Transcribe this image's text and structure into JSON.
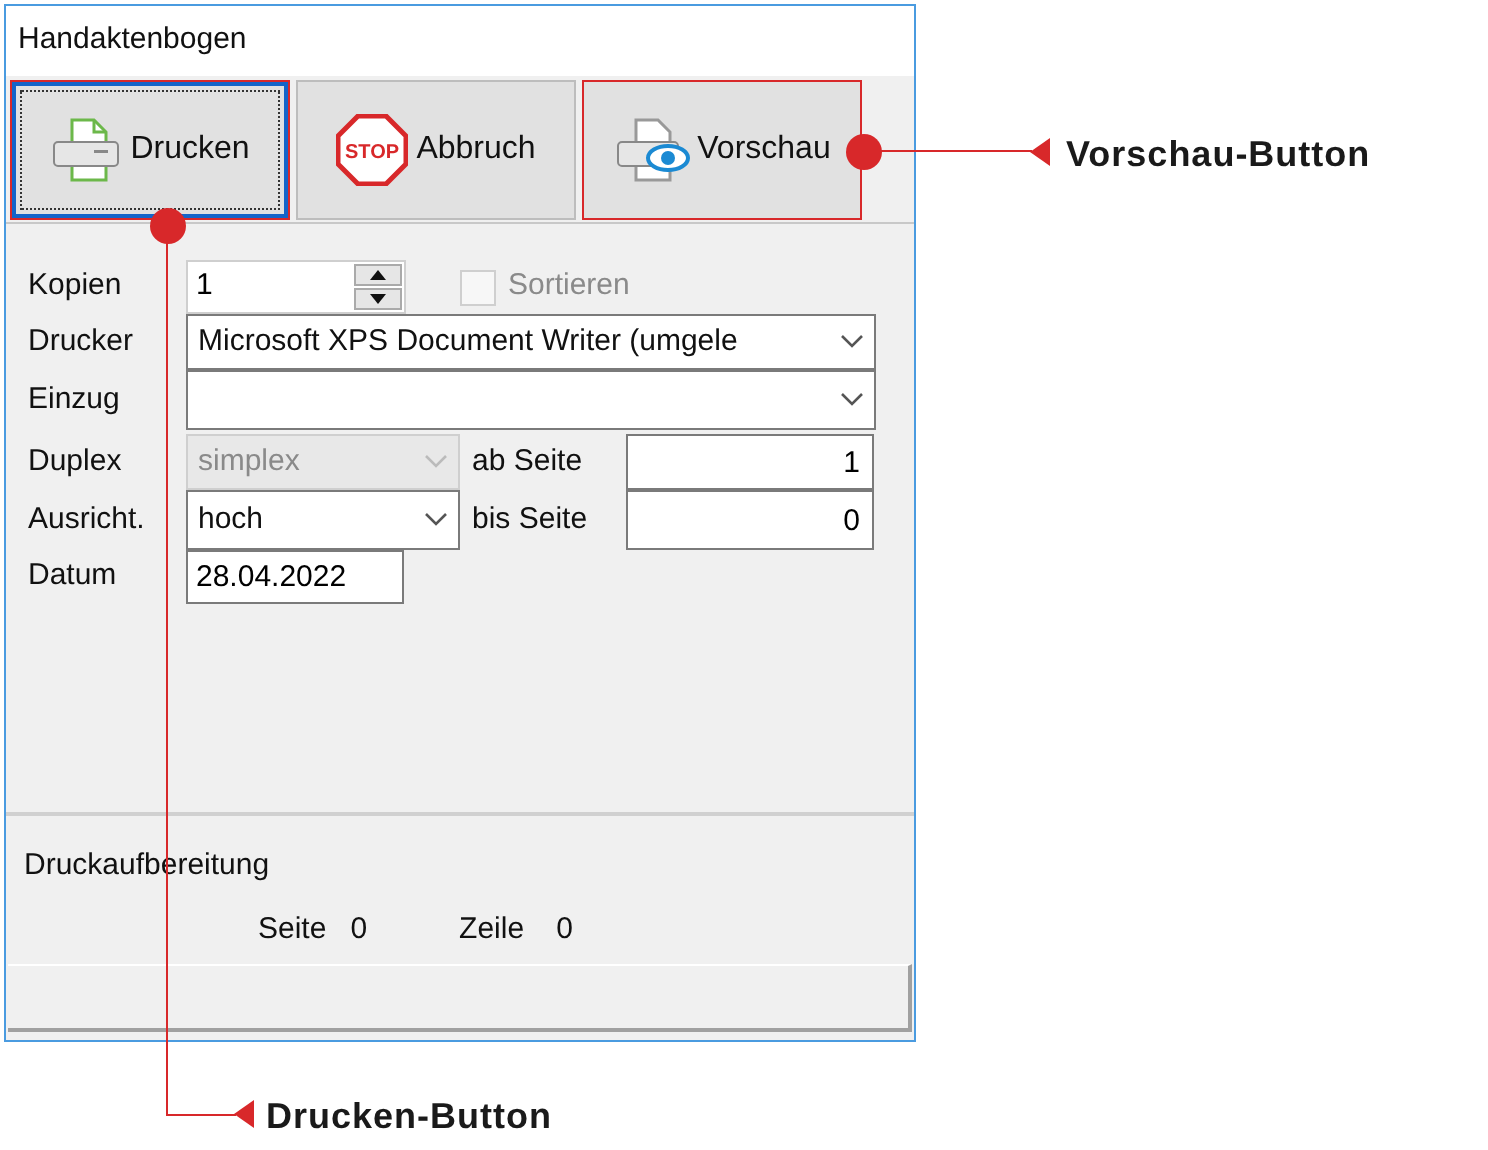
{
  "window": {
    "title": "Handaktenbogen"
  },
  "toolbar": [
    {
      "kind": "print",
      "label": "Drucken",
      "focused": true,
      "highlighted": true
    },
    {
      "kind": "stop",
      "label": "Abbruch",
      "icon_text": "STOP",
      "focused": false,
      "highlighted": false
    },
    {
      "kind": "preview",
      "label": "Vorschau",
      "focused": false,
      "highlighted": true
    }
  ],
  "form": {
    "copies": {
      "label": "Kopien",
      "value": "1"
    },
    "collate": {
      "label": "Sortieren",
      "checked": false,
      "disabled": true
    },
    "printer": {
      "label": "Drucker",
      "value": "Microsoft XPS Document Writer (umgele"
    },
    "tray": {
      "label": "Einzug"
    },
    "duplex": {
      "label": "Duplex",
      "value": "simplex",
      "disabled": true
    },
    "from_page": {
      "label": "ab Seite",
      "value": "1"
    },
    "orientation": {
      "label": "Ausricht.",
      "value": "hoch",
      "disabled": false
    },
    "to_page": {
      "label": "bis Seite",
      "value": "0"
    },
    "date": {
      "label": "Datum",
      "value": "28.04.2022"
    }
  },
  "progress": {
    "title": "Druckaufbereitung",
    "page_label": "Seite",
    "page_value": "0",
    "line_label": "Zeile",
    "line_value": "0"
  },
  "annotations": [
    {
      "label": "Vorschau-Button",
      "kind": "right"
    },
    {
      "label": "Drucken-Button",
      "kind": "below"
    }
  ]
}
